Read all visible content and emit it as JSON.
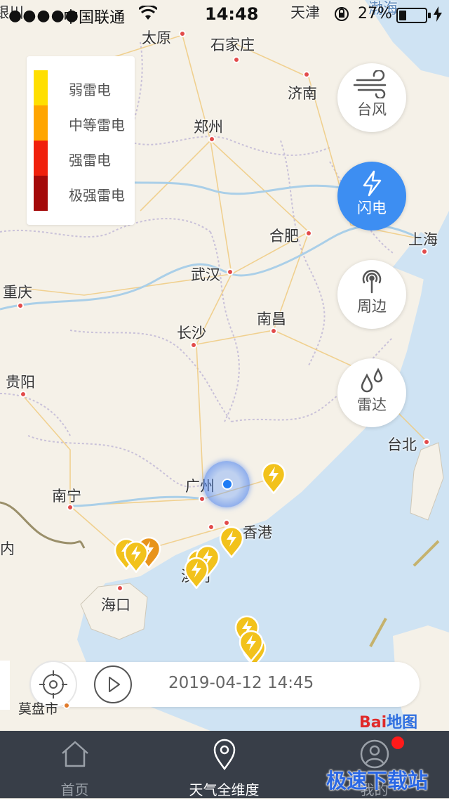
{
  "status": {
    "signal": "●●●●●",
    "carrier": "中国联通",
    "time": "14:48",
    "battery": "27%"
  },
  "map": {
    "cities": [
      {
        "name": "太原"
      },
      {
        "name": "石家庄"
      },
      {
        "name": "天津"
      },
      {
        "name": "济南"
      },
      {
        "name": "郑州"
      },
      {
        "name": "合肥"
      },
      {
        "name": "上海"
      },
      {
        "name": "武汉"
      },
      {
        "name": "重庆"
      },
      {
        "name": "南昌"
      },
      {
        "name": "长沙"
      },
      {
        "name": "贵阳"
      },
      {
        "name": "台北"
      },
      {
        "name": "广州"
      },
      {
        "name": "南宁"
      },
      {
        "name": "香港"
      },
      {
        "name": "澳门"
      },
      {
        "name": "海口"
      }
    ],
    "edge_labels": {
      "top_left": "银川",
      "left_mid": "内",
      "right_top": "渤海"
    },
    "mohai": "莫盘市",
    "provider": {
      "red": "Bai",
      "blue": "地图"
    }
  },
  "legend": {
    "items": [
      {
        "label": "弱雷电",
        "color": "#ffdf00"
      },
      {
        "label": "中等雷电",
        "color": "#ffa500"
      },
      {
        "label": "强雷电",
        "color": "#f0200c"
      },
      {
        "label": "极强雷电",
        "color": "#a40a0a"
      }
    ]
  },
  "side_buttons": {
    "typhoon": "台风",
    "lightning": "闪电",
    "nearby": "周边",
    "radar": "雷达"
  },
  "timebar": {
    "timestamp": "2019-04-12 14:45"
  },
  "tabbar": {
    "tabs": [
      {
        "label": "首页"
      },
      {
        "label": "天气全维度"
      },
      {
        "label": "我的"
      }
    ]
  },
  "watermark": "极速下载站",
  "colors": {
    "accent": "#3d8ef2",
    "tabbar": "#383e48",
    "badge": "#ff1a1a"
  }
}
